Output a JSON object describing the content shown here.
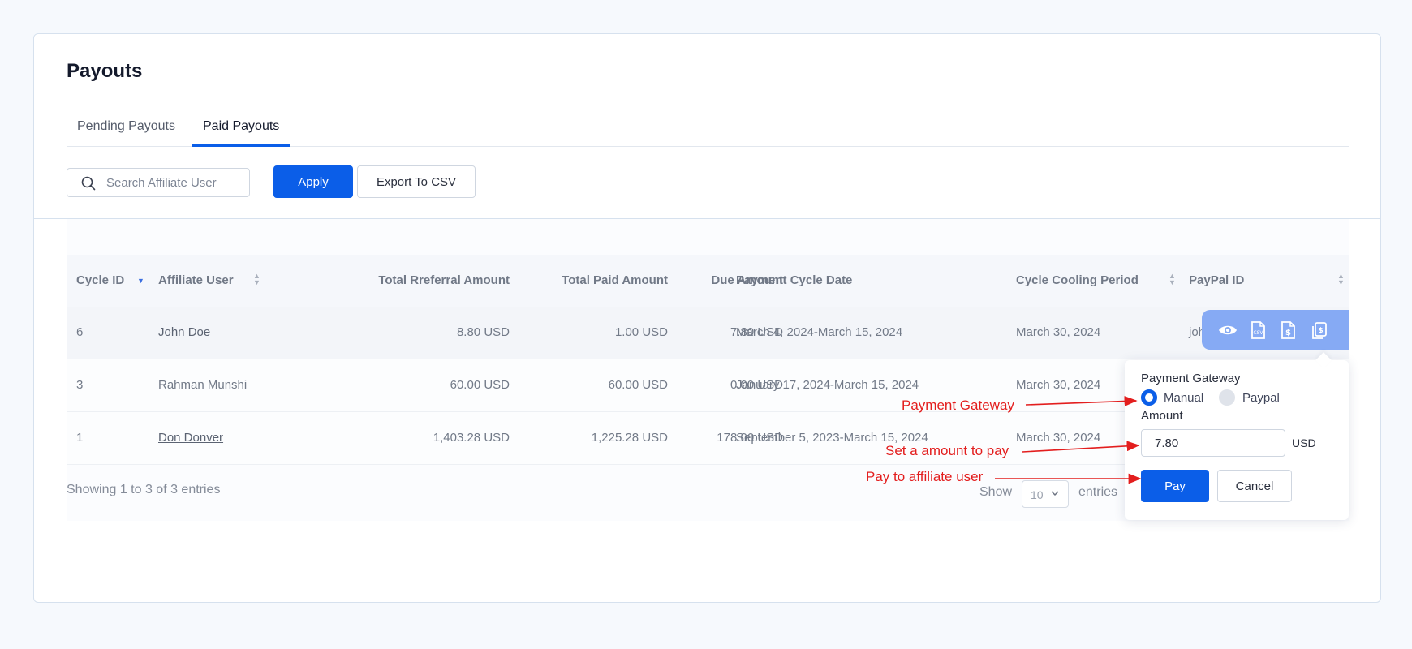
{
  "page": {
    "title": "Payouts"
  },
  "tabs": [
    {
      "label": "Pending Payouts",
      "active": false
    },
    {
      "label": "Paid Payouts",
      "active": true
    }
  ],
  "toolbar": {
    "search_placeholder": "Search Affiliate User",
    "search_value": "",
    "apply_label": "Apply",
    "export_label": "Export To CSV"
  },
  "table": {
    "headers": {
      "cycle_id": "Cycle ID",
      "affiliate_user": "Affiliate User",
      "total_referral": "Total Rreferral Amount",
      "total_paid": "Total Paid Amount",
      "due": "Due Amount",
      "cycle_date": "Payment Cycle Date",
      "cooling": "Cycle Cooling Period",
      "paypal": "PayPal ID"
    },
    "rows": [
      {
        "cycle_id": "6",
        "user": "John Doe",
        "referral": "8.80 USD",
        "paid": "1.00 USD",
        "due": "7.80 USD",
        "date": "March 4, 2024-March 15, 2024",
        "cooling": "March 30, 2024",
        "paypal": "joh"
      },
      {
        "cycle_id": "3",
        "user": "Rahman Munshi",
        "referral": "60.00 USD",
        "paid": "60.00 USD",
        "due": "0.00 USD",
        "date": "January 17, 2024-March 15, 2024",
        "cooling": "March 30, 2024",
        "paypal": ""
      },
      {
        "cycle_id": "1",
        "user": "Don Donver",
        "referral": "1,403.28 USD",
        "paid": "1,225.28 USD",
        "due": "178.00 USD",
        "date": "September 5, 2023-March 15, 2024",
        "cooling": "March 30, 2024",
        "paypal": ""
      }
    ],
    "footer": {
      "showing": "Showing 1 to 3 of 3 entries",
      "show_label": "Show",
      "page_size": "10",
      "entries_label": "entries"
    }
  },
  "actions": {
    "icons": [
      "eye-icon",
      "csv-file-icon",
      "dollar-file-icon",
      "copy-dollar-icon"
    ]
  },
  "popover": {
    "gateway_label": "Payment Gateway",
    "options": [
      {
        "label": "Manual",
        "selected": true
      },
      {
        "label": "Paypal",
        "selected": false
      }
    ],
    "amount_label": "Amount",
    "amount_value": "7.80",
    "currency": "USD",
    "pay_label": "Pay",
    "cancel_label": "Cancel"
  },
  "annotations": {
    "gateway": "Payment Gateway",
    "amount": "Set a amount to pay",
    "pay": "Pay to affiliate user"
  },
  "colors": {
    "primary": "#0b5ee8",
    "annotation": "#e31e1e",
    "action_bar": "#86aaf4"
  }
}
